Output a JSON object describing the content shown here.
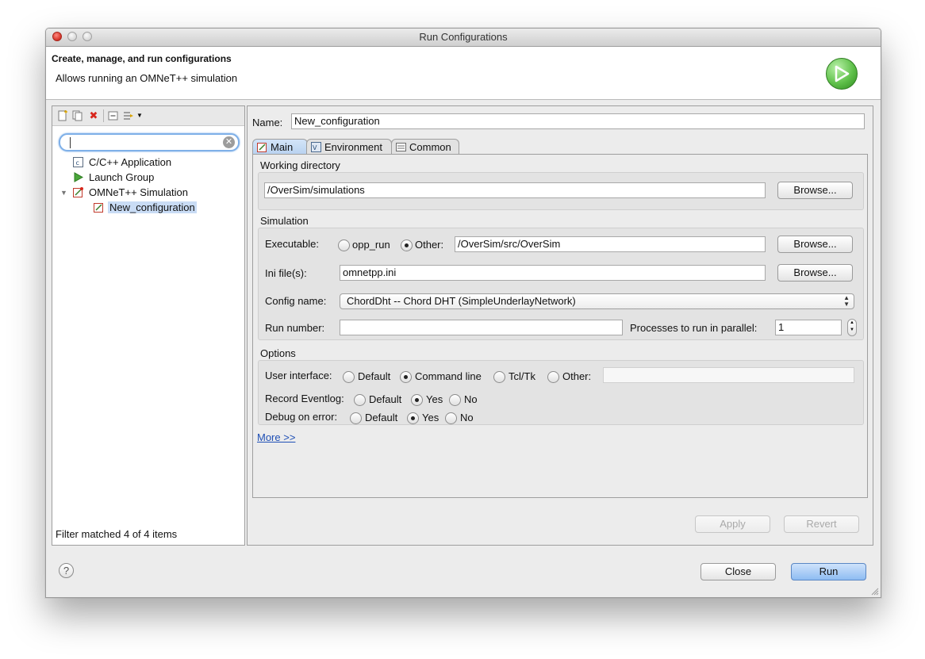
{
  "window": {
    "title": "Run Configurations"
  },
  "banner": {
    "title": "Create, manage, and run configurations",
    "description": "Allows running an OMNeT++ simulation"
  },
  "left": {
    "search": {
      "value": "",
      "placeholder": ""
    },
    "tree": [
      {
        "label": "C/C++ Application"
      },
      {
        "label": "Launch Group"
      },
      {
        "label": "OMNeT++ Simulation"
      },
      {
        "label": "New_configuration"
      }
    ],
    "filter_status": "Filter matched 4 of 4 items"
  },
  "right": {
    "name_label": "Name:",
    "name_value": "New_configuration",
    "tabs": [
      {
        "label": "Main"
      },
      {
        "label": "Environment"
      },
      {
        "label": "Common"
      }
    ],
    "working_directory": {
      "title": "Working directory",
      "value": "/OverSim/simulations",
      "browse": "Browse..."
    },
    "simulation": {
      "title": "Simulation",
      "executable_label": "Executable:",
      "opp_run": "opp_run",
      "other": "Other:",
      "executable_value": "/OverSim/src/OverSim",
      "browse1": "Browse...",
      "ini_label": "Ini file(s):",
      "ini_value": "omnetpp.ini",
      "browse2": "Browse...",
      "config_label": "Config name:",
      "config_value": "ChordDht -- Chord DHT (SimpleUnderlayNetwork)",
      "run_number_label": "Run number:",
      "run_number_value": "",
      "processes_label": "Processes to run in parallel:",
      "processes_value": "1"
    },
    "options": {
      "title": "Options",
      "ui_label": "User interface:",
      "ui_default": "Default",
      "ui_cmdline": "Command line",
      "ui_tcltk": "Tcl/Tk",
      "ui_other": "Other:",
      "ui_other_value": "",
      "eventlog_label": "Record Eventlog:",
      "eventlog_default": "Default",
      "eventlog_yes": "Yes",
      "eventlog_no": "No",
      "debug_label": "Debug on error:",
      "debug_default": "Default",
      "debug_yes": "Yes",
      "debug_no": "No"
    },
    "more_link": "More >>",
    "apply": "Apply",
    "revert": "Revert"
  },
  "footer": {
    "help": "?",
    "close": "Close",
    "run": "Run"
  },
  "colors": {
    "accent_blue": "#8ebcf2",
    "selection": "#c9dcf5",
    "link": "#1f4fb5",
    "delete_red": "#d8261c",
    "run_green": "#5fc04a"
  }
}
